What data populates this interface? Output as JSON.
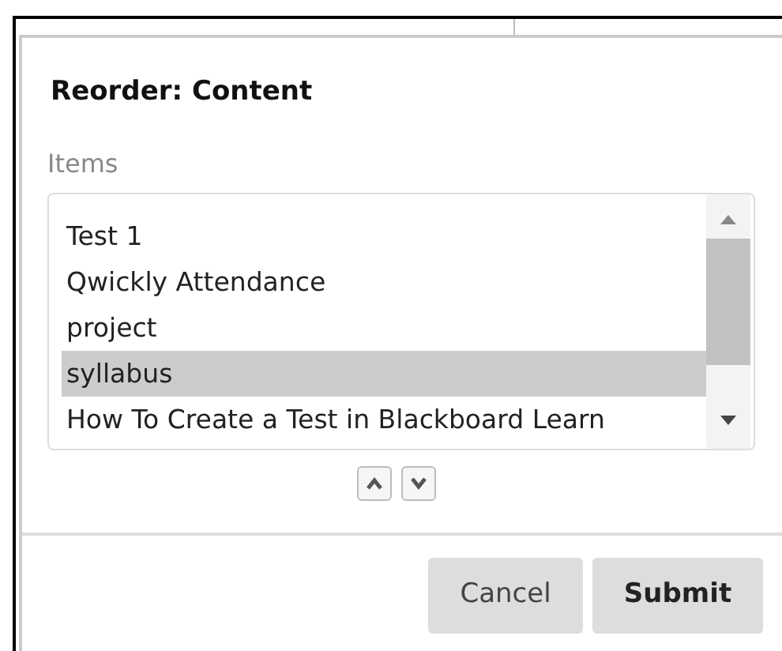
{
  "dialog": {
    "title": "Reorder: Content"
  },
  "list": {
    "label": "Items",
    "items": [
      {
        "text": "Test 1",
        "selected": false
      },
      {
        "text": "Qwickly Attendance",
        "selected": false
      },
      {
        "text": "project",
        "selected": false
      },
      {
        "text": "syllabus",
        "selected": true
      },
      {
        "text": "How To Create a Test in Blackboard Learn",
        "selected": false
      }
    ]
  },
  "buttons": [
    {
      "label": "Cancel",
      "kind": "secondary"
    },
    {
      "label": "Submit",
      "kind": "primary"
    }
  ]
}
